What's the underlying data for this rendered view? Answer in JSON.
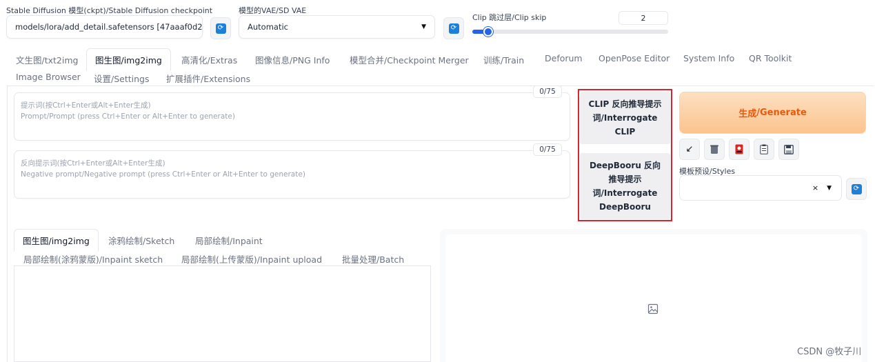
{
  "settings": {
    "checkpoint_label": "Stable Diffusion 模型(ckpt)/Stable Diffusion checkpoint",
    "checkpoint_value": "models/lora/add_detail.safetensors [47aaaf0d2",
    "vae_label": "模型的VAE/SD VAE",
    "vae_value": "Automatic",
    "clip_label": "Clip 跳过层/Clip skip",
    "clip_value": "2",
    "clip_level_fraction": 0.08
  },
  "tabs": [
    {
      "label": "文生图/txt2img"
    },
    {
      "label": "图生图/img2img"
    },
    {
      "label": "高清化/Extras"
    },
    {
      "label": "图像信息/PNG Info"
    },
    {
      "label": "模型合并/Checkpoint Merger"
    },
    {
      "label": "训练/Train"
    },
    {
      "label": "Deforum"
    },
    {
      "label": "OpenPose Editor"
    },
    {
      "label": "System Info"
    },
    {
      "label": "QR Toolkit"
    },
    {
      "label": "Image Browser"
    },
    {
      "label": "设置/Settings"
    },
    {
      "label": "扩展插件/Extensions"
    }
  ],
  "prompt": {
    "placeholder_line1": "提示词(按Ctrl+Enter或Alt+Enter生成)",
    "placeholder_line2": "Prompt/Prompt (press Ctrl+Enter or Alt+Enter to generate)",
    "counter": "0/75"
  },
  "negative_prompt": {
    "placeholder_line1": "反向提示词(按Ctrl+Enter或Alt+Enter生成)",
    "placeholder_line2": "Negative prompt/Negative prompt (press Ctrl+Enter or Alt+Enter to generate)",
    "counter": "0/75"
  },
  "interrogate": {
    "clip_label": "CLIP 反向推导提示词/Interrogate CLIP",
    "deepbooru_label": "DeepBooru 反向推导提示词/Interrogate DeepBooru"
  },
  "generate": {
    "label_cn": "生成",
    "label_en": "/Generate"
  },
  "tools": [
    "arrow-icon",
    "trash-icon",
    "red-card-icon",
    "clipboard-icon",
    "save-icon"
  ],
  "styles": {
    "label": "模板预设/Styles",
    "clear": "×"
  },
  "subtabs": [
    {
      "label": "图生图/img2img"
    },
    {
      "label": "涂鸦绘制/Sketch"
    },
    {
      "label": "局部绘制/Inpaint"
    },
    {
      "label": "局部绘制(涂鸦蒙版)/Inpaint sketch"
    },
    {
      "label": "局部绘制(上传蒙版)/Inpaint upload"
    },
    {
      "label": "批量处理/Batch"
    }
  ],
  "watermark": "CSDN @牧子川",
  "colors": {
    "accent": "#2563eb",
    "generate_text": "#ea580c",
    "highlight_border": "#d9232d",
    "refresh_icon": "#1e7fd8"
  }
}
